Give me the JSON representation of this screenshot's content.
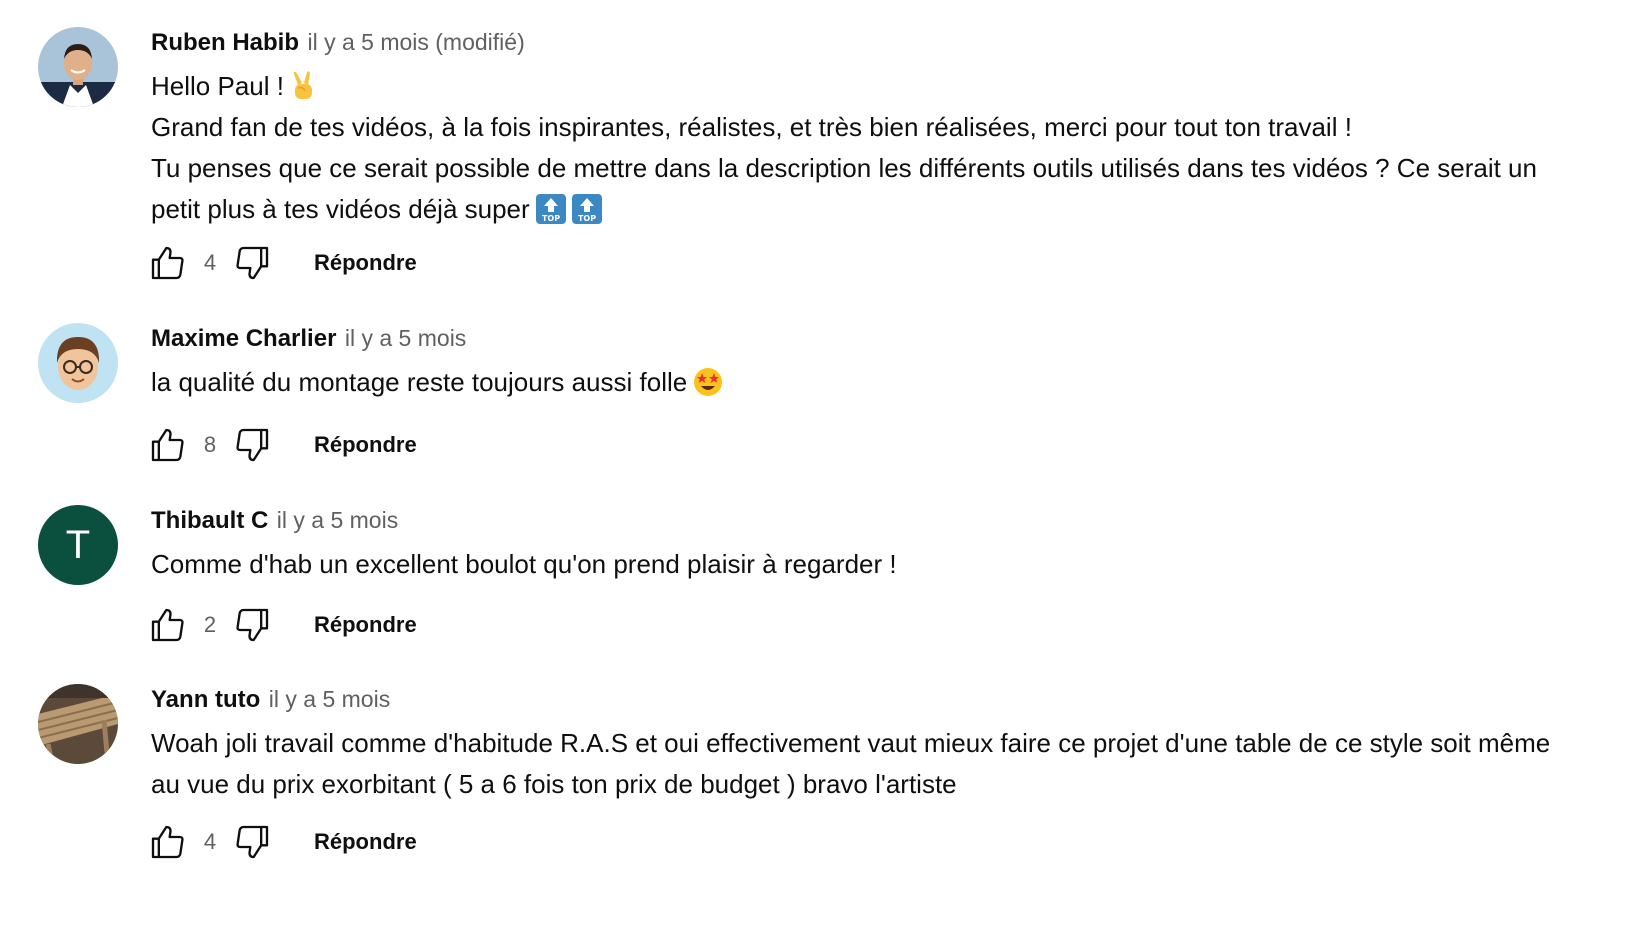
{
  "comments": [
    {
      "author": "Ruben Habib",
      "time": "il y a 5 mois (modifié)",
      "lines": [
        "Hello Paul !",
        "Grand fan de tes vidéos, à la fois inspirantes, réalistes, et très bien réalisées, merci pour tout ton travail !",
        "Tu penses que ce serait possible de mettre dans la description les différents outils utilisés dans tes vidéos ? Ce serait un petit plus à tes vidéos déjà super"
      ],
      "emojis": [
        "victory-hand",
        "top-arrow",
        "top-arrow"
      ],
      "likes": "4",
      "reply_label": "Répondre"
    },
    {
      "author": "Maxime Charlier",
      "time": "il y a 5 mois",
      "lines": [
        "la qualité du montage reste toujours aussi folle"
      ],
      "emojis": [
        "star-struck"
      ],
      "likes": "8",
      "reply_label": "Répondre"
    },
    {
      "author": "Thibault C",
      "time": "il y a 5 mois",
      "avatar_letter": "T",
      "lines": [
        "Comme d'hab un excellent boulot qu'on prend plaisir à regarder !"
      ],
      "likes": "2",
      "reply_label": "Répondre"
    },
    {
      "author": "Yann tuto",
      "time": "il y a 5 mois",
      "lines": [
        "Woah joli travail comme d'habitude R.A.S et oui effectivement vaut mieux faire ce projet d'une table de ce style soit même au vue du prix exorbitant ( 5 a 6 fois ton prix de budget ) bravo l'artiste"
      ],
      "likes": "4",
      "reply_label": "Répondre"
    }
  ],
  "emoji_labels": {
    "top": "TOP"
  },
  "colors": {
    "text": "#0f0f0f",
    "secondary": "#606060",
    "avatar_letter_bg": "#0b4f3f",
    "top_emoji_bg": "#3b88c3"
  }
}
